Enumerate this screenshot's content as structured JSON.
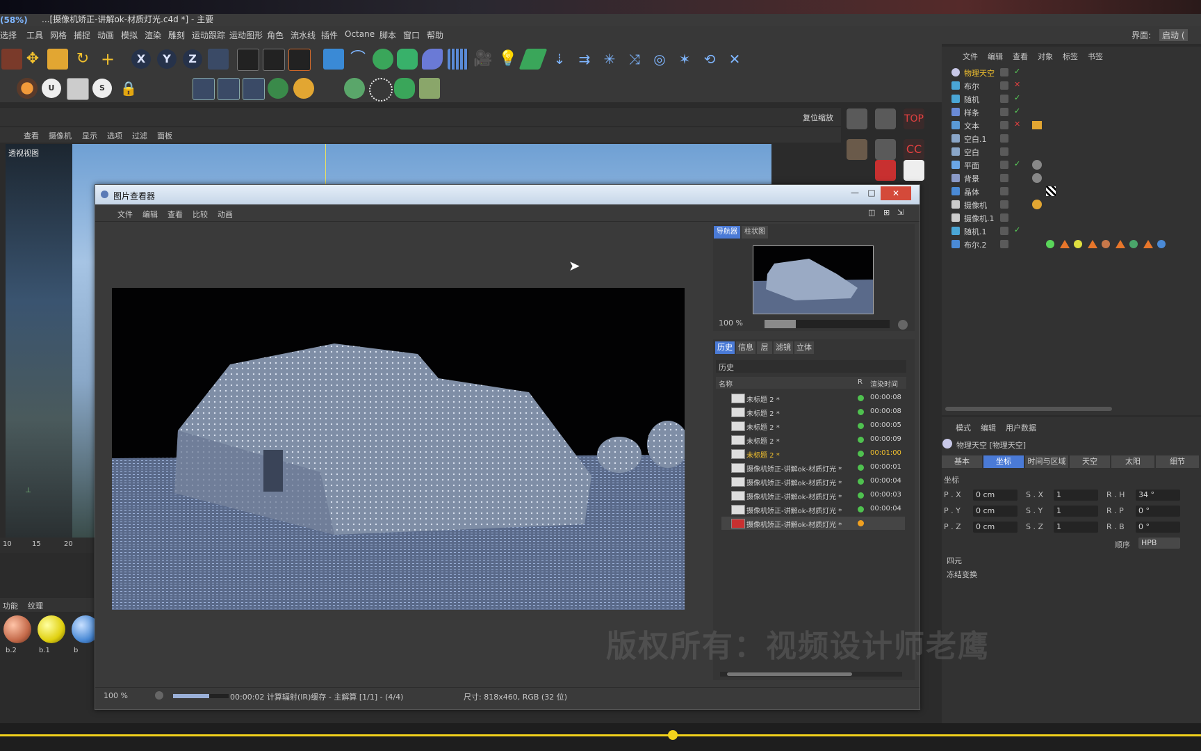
{
  "app": {
    "fps": "(58%)",
    "title": "...[摄像机矫正-讲解ok-材质灯光.c4d *] - 主要",
    "right_label": "界面:",
    "right_value": "启动 ("
  },
  "menus": [
    "选择",
    "工具",
    "网格",
    "捕捉",
    "动画",
    "模拟",
    "渲染",
    "雕刻",
    "运动跟踪",
    "运动图形",
    "角色",
    "流水线",
    "插件",
    "Octane",
    "脚本",
    "窗口",
    "帮助"
  ],
  "view_menu": [
    "查看",
    "摄像机",
    "显示",
    "选项",
    "过滤",
    "面板"
  ],
  "viewport": {
    "label": "透视视图",
    "ruler": [
      "10",
      "15",
      "20"
    ]
  },
  "material_panel": {
    "tabs": [
      "功能",
      "纹理"
    ],
    "labels": [
      "b.2",
      "b.1",
      "b"
    ]
  },
  "image_viewer": {
    "title": "图片查看器",
    "menu": [
      "文件",
      "编辑",
      "查看",
      "比较",
      "动画"
    ],
    "nav_tabs": [
      "导航器",
      "柱状图"
    ],
    "zoom": "100 %",
    "hist_tabs": [
      "历史",
      "信息",
      "层",
      "滤镜",
      "立体"
    ],
    "history_title": "历史",
    "columns": {
      "name": "名称",
      "r": "R",
      "time": "渲染时间"
    },
    "rows": [
      {
        "name": "未标题 2 *",
        "time": "00:00:08",
        "status": "#4fc14f",
        "active": false
      },
      {
        "name": "未标题 2 *",
        "time": "00:00:08",
        "status": "#4fc14f",
        "active": false
      },
      {
        "name": "未标题 2 *",
        "time": "00:00:05",
        "status": "#4fc14f",
        "active": false
      },
      {
        "name": "未标题 2 *",
        "time": "00:00:09",
        "status": "#4fc14f",
        "active": false
      },
      {
        "name": "未标题 2 *",
        "time": "00:01:00",
        "status": "#4fc14f",
        "active": true
      },
      {
        "name": "摄像机矫正-讲解ok-材质灯光 *",
        "time": "00:00:01",
        "status": "#4fc14f",
        "active": false
      },
      {
        "name": "摄像机矫正-讲解ok-材质灯光 *",
        "time": "00:00:04",
        "status": "#4fc14f",
        "active": false
      },
      {
        "name": "摄像机矫正-讲解ok-材质灯光 *",
        "time": "00:00:03",
        "status": "#4fc14f",
        "active": false
      },
      {
        "name": "摄像机矫正-讲解ok-材质灯光 *",
        "time": "00:00:04",
        "status": "#4fc14f",
        "active": false
      },
      {
        "name": "摄像机矫正-讲解ok-材质灯光 *",
        "time": "",
        "status": "#f0a020",
        "active": false
      }
    ],
    "status_zoom": "100 %",
    "status_text": "00:00:02 计算辐射(IR)缓存 - 主解算 [1/1] - (4/4)",
    "status_size": "尺寸: 818x460, RGB (32 位)"
  },
  "object_manager": {
    "menu": [
      "文件",
      "编辑",
      "查看",
      "对象",
      "标签",
      "书签"
    ],
    "objects": [
      {
        "name": "物理天空",
        "icon": "sky-icon",
        "highlight": true
      },
      {
        "name": "布尔",
        "icon": "boolean-icon",
        "highlight": false
      },
      {
        "name": "随机",
        "icon": "random-icon",
        "highlight": false
      },
      {
        "name": "样条",
        "icon": "spline-icon",
        "highlight": false
      },
      {
        "name": "文本",
        "icon": "text-icon",
        "highlight": false
      },
      {
        "name": "空白.1",
        "icon": "null-icon",
        "highlight": false
      },
      {
        "name": "空白",
        "icon": "null-icon",
        "highlight": false
      },
      {
        "name": "平面",
        "icon": "plane-icon",
        "highlight": false
      },
      {
        "name": "背景",
        "icon": "background-icon",
        "highlight": false
      },
      {
        "name": "晶体",
        "icon": "crystal-icon",
        "highlight": false
      },
      {
        "name": "摄像机",
        "icon": "camera-icon",
        "highlight": false
      },
      {
        "name": "摄像机.1",
        "icon": "camera-icon",
        "highlight": false
      },
      {
        "name": "随机.1",
        "icon": "random-icon",
        "highlight": false
      },
      {
        "name": "布尔.2",
        "icon": "boolean-icon",
        "highlight": false
      }
    ]
  },
  "attribute_manager": {
    "menu": [
      "模式",
      "编辑",
      "用户数据"
    ],
    "object_label": "物理天空 [物理天空]",
    "tabs": [
      "基本",
      "坐标",
      "时间与区域",
      "天空",
      "太阳",
      "细节"
    ],
    "active_tab": "坐标",
    "section": "坐标",
    "fields": {
      "px_label": "P . X",
      "px": "0 cm",
      "py_label": "P . Y",
      "py": "0 cm",
      "pz_label": "P . Z",
      "pz": "0 cm",
      "sx_label": "S . X",
      "sx": "1",
      "sy_label": "S . Y",
      "sy": "1",
      "sz_label": "S . Z",
      "sz": "1",
      "rh_label": "R . H",
      "rh": "34 °",
      "rp_label": "R . P",
      "rp": "0 °",
      "rb_label": "R . B",
      "rb": "0 °"
    },
    "order_label": "顺序",
    "order_value": "HPB",
    "group1": "四元",
    "group2": "冻结变换"
  },
  "toolbar3": {
    "reset_scale": "复位缩放"
  },
  "watermark": "版权所有：视频设计师老鹰"
}
